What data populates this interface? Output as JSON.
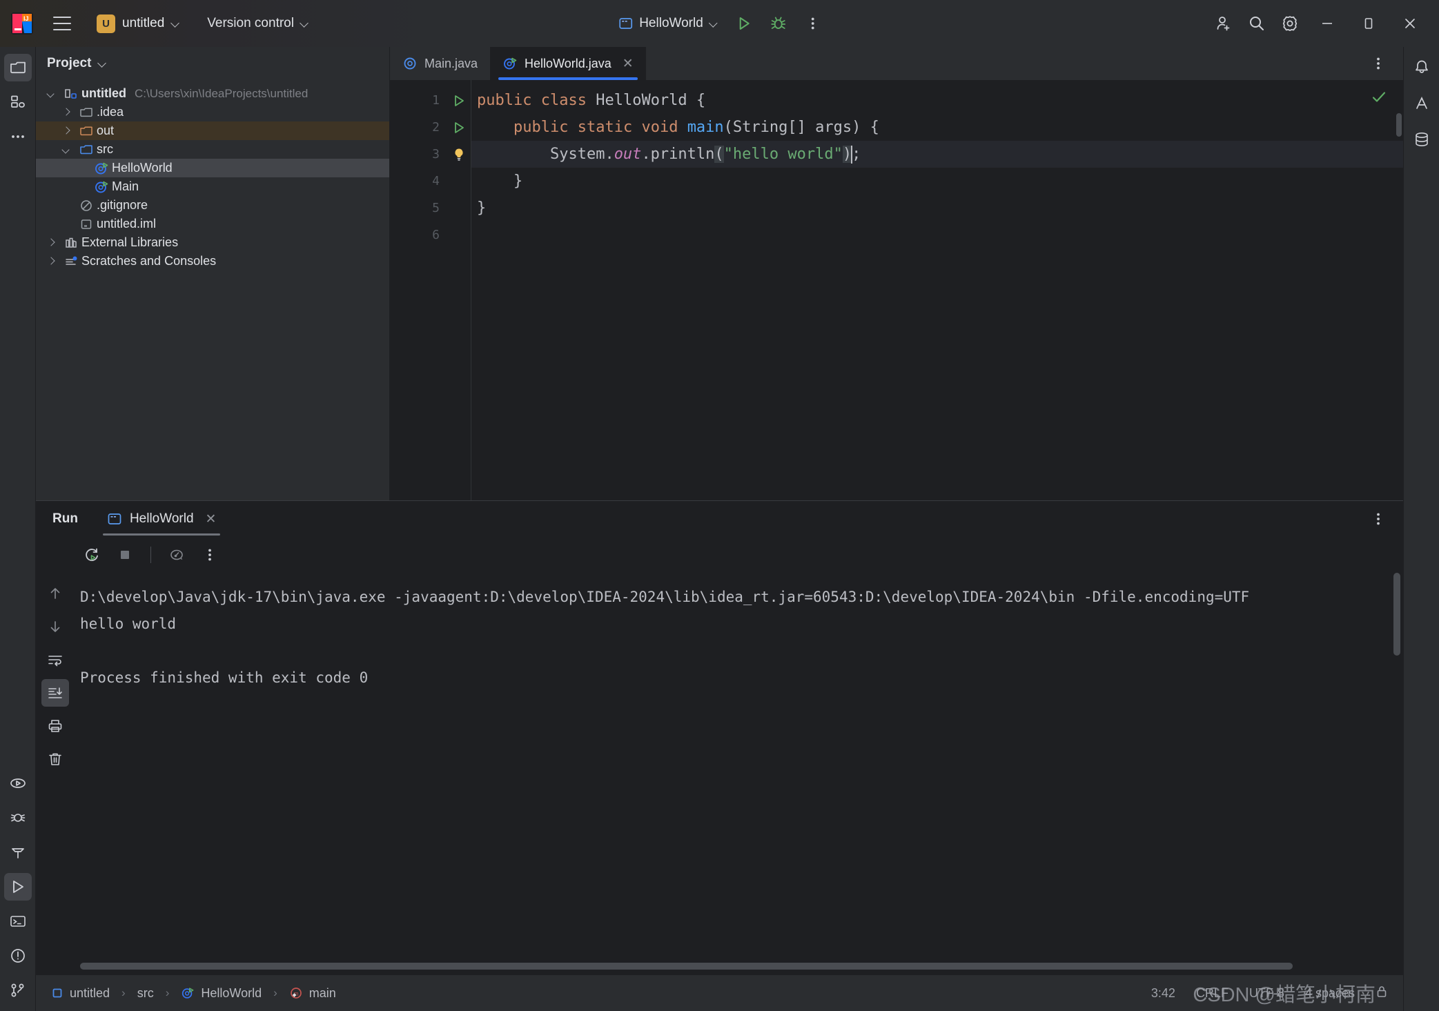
{
  "titlebar": {
    "logo_icon": "intellij-idea-logo",
    "menu_icon": "hamburger-menu-icon",
    "project_badge": "U",
    "project_name": "untitled",
    "version_control": "Version control",
    "run_config": "HelloWorld",
    "run_icon": "run-play-icon",
    "debug_icon": "debug-bug-icon",
    "more_icon": "more-vertical-icon",
    "share_icon": "add-user-icon",
    "search_icon": "search-icon",
    "settings_icon": "settings-gear-icon",
    "minimize_icon": "minimize-icon",
    "maximize_icon": "maximize-icon",
    "close_icon": "close-icon"
  },
  "rail": {
    "top": [
      {
        "name": "project-tool-window",
        "icon": "folder-icon",
        "active": true
      },
      {
        "name": "structure-tool-window",
        "icon": "structure-icon",
        "active": false
      },
      {
        "name": "more-tool-windows",
        "icon": "more-horizontal-icon",
        "active": false
      }
    ],
    "bottom": [
      {
        "name": "run-anything",
        "icon": "run-oval-icon",
        "active": false
      },
      {
        "name": "debug-tool-window",
        "icon": "bug-icon",
        "active": false
      },
      {
        "name": "build-tool-window",
        "icon": "hammer-icon",
        "active": false
      },
      {
        "name": "run-tool-window",
        "icon": "play-icon",
        "active": true
      },
      {
        "name": "terminal-tool-window",
        "icon": "terminal-icon",
        "active": false
      },
      {
        "name": "problems-tool-window",
        "icon": "warning-circle-icon",
        "active": false
      },
      {
        "name": "version-control-tool-window",
        "icon": "git-branch-icon",
        "active": false
      }
    ]
  },
  "notif_rail": [
    {
      "name": "notifications",
      "icon": "bell-icon"
    },
    {
      "name": "ai-assistant",
      "icon": "ai-icon"
    },
    {
      "name": "database",
      "icon": "database-icon"
    }
  ],
  "project": {
    "title": "Project",
    "tree": [
      {
        "label": "untitled",
        "path": "C:\\Users\\xin\\IdeaProjects\\untitled",
        "icon": "project-module-icon",
        "indent": 0,
        "twist": "down",
        "bold": true,
        "state": "normal"
      },
      {
        "label": ".idea",
        "path": "",
        "icon": "folder-grey-icon",
        "indent": 1,
        "twist": "right",
        "bold": false,
        "state": "normal"
      },
      {
        "label": "out",
        "path": "",
        "icon": "folder-orange-icon",
        "indent": 1,
        "twist": "right",
        "bold": false,
        "state": "highlight"
      },
      {
        "label": "src",
        "path": "",
        "icon": "folder-blue-icon",
        "indent": 1,
        "twist": "down",
        "bold": false,
        "state": "normal"
      },
      {
        "label": "HelloWorld",
        "path": "",
        "icon": "java-class-run-icon",
        "indent": 2,
        "twist": "none",
        "bold": false,
        "state": "selected"
      },
      {
        "label": "Main",
        "path": "",
        "icon": "java-class-run-icon",
        "indent": 2,
        "twist": "none",
        "bold": false,
        "state": "normal"
      },
      {
        "label": ".gitignore",
        "path": "",
        "icon": "gitignore-icon",
        "indent": 1,
        "twist": "none",
        "bold": false,
        "state": "normal"
      },
      {
        "label": "untitled.iml",
        "path": "",
        "icon": "iml-file-icon",
        "indent": 1,
        "twist": "none",
        "bold": false,
        "state": "normal"
      },
      {
        "label": "External Libraries",
        "path": "",
        "icon": "libraries-icon",
        "indent": 0,
        "twist": "right",
        "bold": false,
        "state": "normal"
      },
      {
        "label": "Scratches and Consoles",
        "path": "",
        "icon": "scratches-icon",
        "indent": 0,
        "twist": "right",
        "bold": false,
        "state": "normal"
      }
    ]
  },
  "editor": {
    "tabs": [
      {
        "label": "Main.java",
        "icon": "java-class-icon",
        "active": false,
        "closable": false
      },
      {
        "label": "HelloWorld.java",
        "icon": "java-class-run-icon",
        "active": true,
        "closable": true
      }
    ],
    "more_icon": "more-vertical-icon",
    "inspection_ok_icon": "checkmark-icon",
    "lines": [
      {
        "no": "1",
        "gutter_icon": "run-gutter-icon"
      },
      {
        "no": "2",
        "gutter_icon": "run-gutter-icon"
      },
      {
        "no": "3",
        "gutter_icon": "lightbulb-icon"
      },
      {
        "no": "4",
        "gutter_icon": ""
      },
      {
        "no": "5",
        "gutter_icon": ""
      },
      {
        "no": "6",
        "gutter_icon": ""
      }
    ],
    "code": {
      "l1_kw1": "public",
      "l1_kw2": "class",
      "l1_name": "HelloWorld",
      "l1_brace": "{",
      "l2_kw1": "public",
      "l2_kw2": "static",
      "l2_kw3": "void",
      "l2_mth": "main",
      "l2_args": "(String[] args) {",
      "l3_sys": "System.",
      "l3_out": "out",
      "l3_print": ".println",
      "l3_paren_open": "(",
      "l3_str": "\"hello world\"",
      "l3_paren_close": ")",
      "l3_semi": ";",
      "l4": "}",
      "l5": "}"
    }
  },
  "run_panel": {
    "title": "Run",
    "tab_label": "HelloWorld",
    "tab_icon": "console-icon",
    "tab_close_icon": "close-icon",
    "more_icon": "more-vertical-icon",
    "toolbar": [
      {
        "name": "rerun-button",
        "icon": "rerun-icon"
      },
      {
        "name": "stop-button",
        "icon": "stop-square-icon"
      },
      {
        "name": "profiler-button",
        "icon": "profiler-gauge-icon"
      },
      {
        "name": "run-options-button",
        "icon": "more-vertical-icon"
      }
    ],
    "console_rail": [
      {
        "name": "prev-occurrence",
        "icon": "arrow-up-icon",
        "active": false
      },
      {
        "name": "next-occurrence",
        "icon": "arrow-down-icon",
        "active": false
      },
      {
        "name": "soft-wrap",
        "icon": "soft-wrap-icon",
        "active": false
      },
      {
        "name": "scroll-to-end",
        "icon": "scroll-to-end-icon",
        "active": true
      },
      {
        "name": "print-button",
        "icon": "printer-icon",
        "active": false
      },
      {
        "name": "clear-all",
        "icon": "trash-icon",
        "active": false
      }
    ],
    "console_lines": [
      "D:\\develop\\Java\\jdk-17\\bin\\java.exe -javaagent:D:\\develop\\IDEA-2024\\lib\\idea_rt.jar=60543:D:\\develop\\IDEA-2024\\bin -Dfile.encoding=UTF",
      "hello world",
      "",
      "Process finished with exit code 0"
    ]
  },
  "status": {
    "breadcrumb": [
      {
        "label": "untitled",
        "icon": "module-icon"
      },
      {
        "label": "src",
        "icon": ""
      },
      {
        "label": "HelloWorld",
        "icon": "java-class-run-icon"
      },
      {
        "label": "main",
        "icon": "method-icon"
      }
    ],
    "separator": "›",
    "position": "3:42",
    "line_separator": "CRLF",
    "encoding": "UTF-8",
    "indent": "4 spaces",
    "lock_icon": "lock-icon",
    "watermark": "CSDN @蜡笔小柯南"
  },
  "colors": {
    "accent_blue": "#3574f0",
    "keyword_orange": "#cf8e6d",
    "string_green": "#6aab73",
    "method_blue": "#56a8f5",
    "field_purple": "#c77dbb",
    "badge_gold": "#d9a343",
    "highlight_brown": "#3e3425",
    "panel_bg": "#2b2d30",
    "editor_bg": "#1e1f22"
  }
}
